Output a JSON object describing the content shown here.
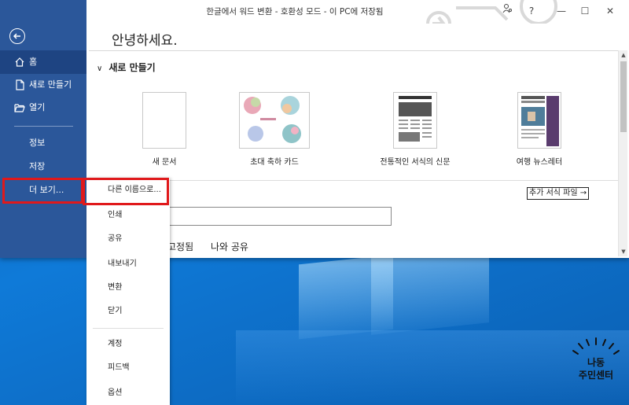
{
  "window": {
    "title": "한글에서 워드 변환 - 호환성 모드 - 이 PC에 저장됨",
    "buttons": {
      "help": "?",
      "minimize": "—",
      "maximize": "☐",
      "close": "✕"
    }
  },
  "nav": {
    "back_icon": "back-arrow-icon",
    "items": [
      {
        "label": "홈",
        "icon": "home-icon"
      },
      {
        "label": "새로 만들기",
        "icon": "new-document-icon"
      },
      {
        "label": "열기",
        "icon": "folder-open-icon"
      },
      {
        "label": "정보"
      },
      {
        "label": "저장"
      },
      {
        "label": "더 보기..."
      }
    ]
  },
  "main": {
    "greeting": "안녕하세요.",
    "new_section": {
      "header": "새로 만들기",
      "templates": [
        {
          "label": "새 문서"
        },
        {
          "label": "초대 축하 카드"
        },
        {
          "label": "전통적인 서식의 신문"
        },
        {
          "label": "여행 뉴스레터"
        }
      ],
      "more_templates": "추가 서식 파일 →"
    },
    "search": {
      "value": ""
    },
    "tabs": [
      "고정됨",
      "나와 공유"
    ]
  },
  "flyout": {
    "items": [
      {
        "label": "다른 이름으로..."
      },
      {
        "label": "인쇄"
      },
      {
        "label": "공유"
      },
      {
        "label": "내보내기"
      },
      {
        "label": "변환"
      },
      {
        "label": "닫기"
      },
      {
        "label": "계정"
      },
      {
        "label": "피드백"
      },
      {
        "label": "옵션"
      }
    ]
  },
  "watermark": {
    "line1": "나동",
    "line2": "주민센터"
  },
  "colors": {
    "nav_bg": "#2b579a",
    "nav_selected": "#1e4482",
    "highlight": "#e0191b",
    "desktop": "#0f7ad8"
  }
}
